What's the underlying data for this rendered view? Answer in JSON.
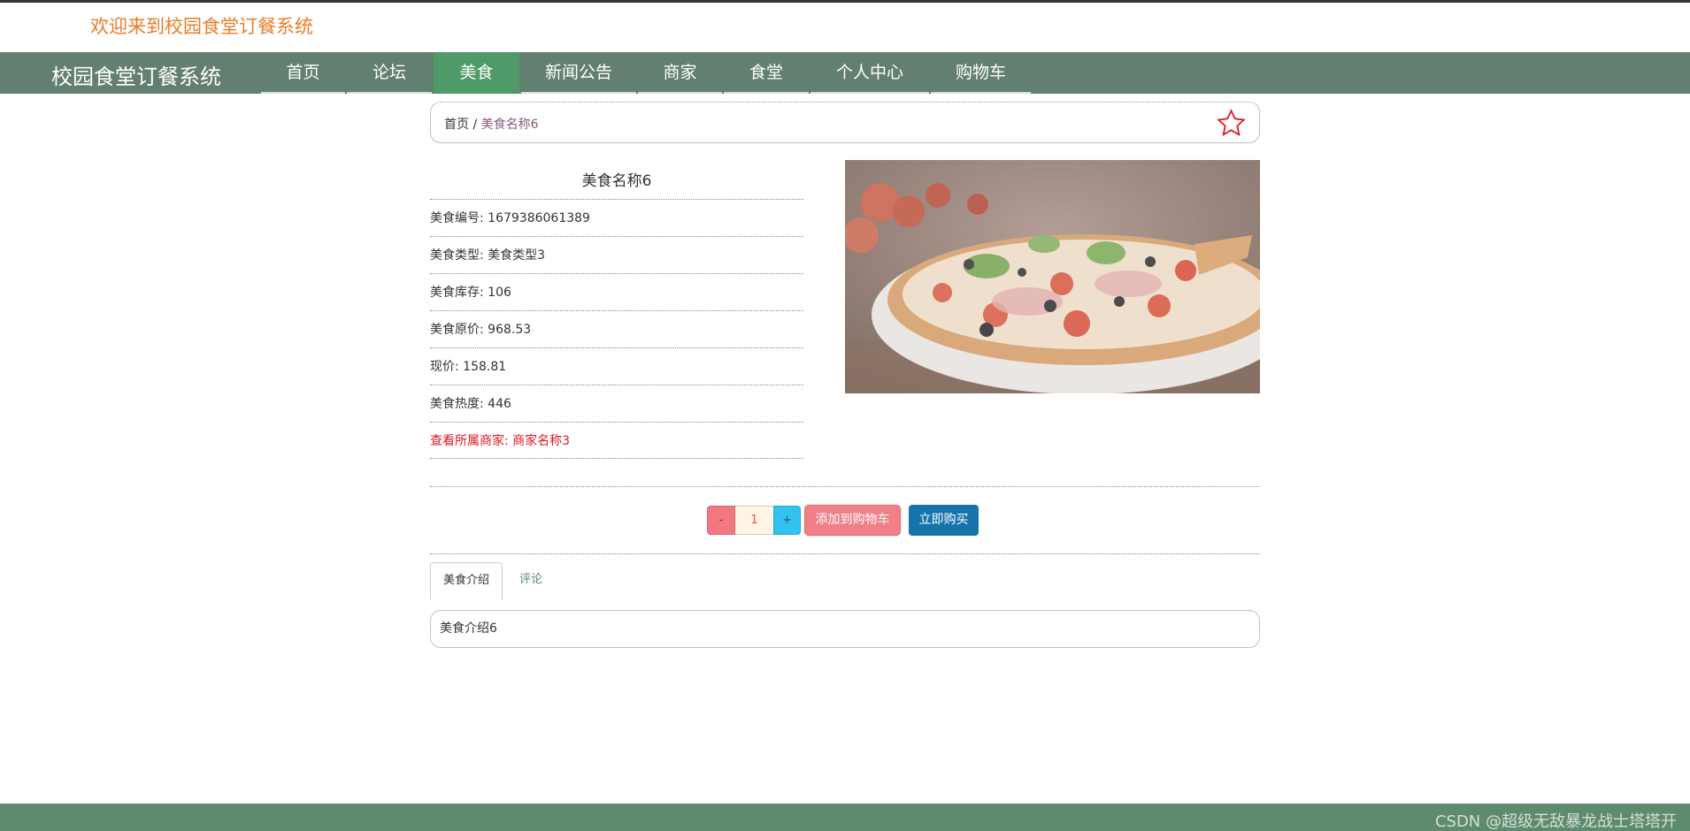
{
  "header": {
    "welcome": "欢迎来到校园食堂订餐系统"
  },
  "nav": {
    "brand": "校园食堂订餐系统",
    "items": [
      {
        "label": "首页"
      },
      {
        "label": "论坛"
      },
      {
        "label": "美食"
      },
      {
        "label": "新闻公告"
      },
      {
        "label": "商家"
      },
      {
        "label": "食堂"
      },
      {
        "label": "个人中心"
      },
      {
        "label": "购物车"
      }
    ],
    "active": "美食"
  },
  "breadcrumb": {
    "home": "首页",
    "sep": "/",
    "current": "美食名称6"
  },
  "product": {
    "title": "美食名称6",
    "fields": [
      "美食编号: 1679386061389",
      "美食类型: 美食类型3",
      "美食库存: 106",
      "美食原价: 968.53",
      "现价: 158.81",
      "美食热度: 446"
    ],
    "merchant_link": "查看所属商家: 商家名称3",
    "image_icon": "pizza-photo"
  },
  "purchase": {
    "minus": "-",
    "quantity": "1",
    "plus": "+",
    "add_to_cart": "添加到购物车",
    "buy_now": "立即购买"
  },
  "tabs": [
    {
      "label": "美食介绍"
    },
    {
      "label": "评论"
    }
  ],
  "description": "美食介绍6",
  "footer": {
    "watermark": "CSDN @超级无敌暴龙战士塔塔开"
  },
  "colors": {
    "nav_bg": "#637f70",
    "nav_active": "#4f9a68",
    "welcome": "#e87e28",
    "link_red": "#e0171f",
    "buy_button": "#1674ad",
    "cart_button": "#f07f88"
  }
}
